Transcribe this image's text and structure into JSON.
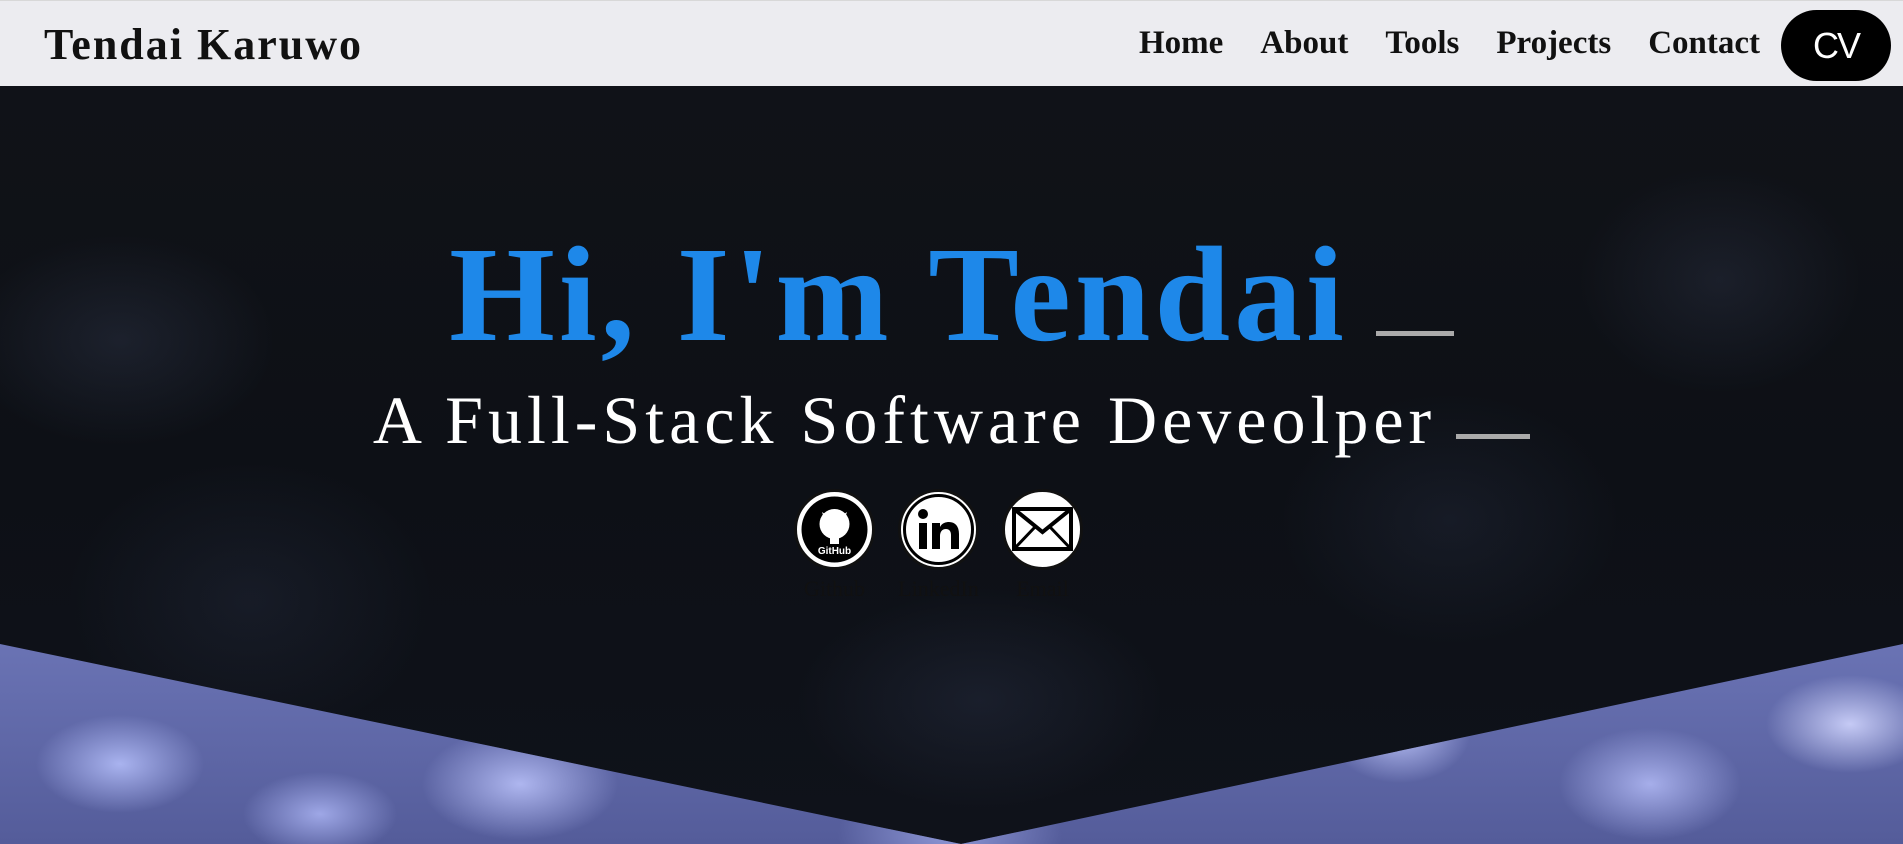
{
  "brand": {
    "name": "Tendai Karuwo"
  },
  "nav": {
    "links": [
      "Home",
      "About",
      "Tools",
      "Projects",
      "Contact"
    ],
    "cv_label": "CV"
  },
  "hero": {
    "title": "Hi, I'm Tendai",
    "subtitle": "A Full-Stack Software Deveolper"
  },
  "socials": [
    {
      "label": "Github",
      "icon": "github-icon",
      "badge": "GitHub"
    },
    {
      "label": "LinkedIn",
      "icon": "linkedin-icon"
    },
    {
      "label": "Email",
      "icon": "email-icon"
    }
  ],
  "colors": {
    "accent": "#1e88e9",
    "navbar": "#f6f6f9",
    "background": "#0c0e13"
  }
}
